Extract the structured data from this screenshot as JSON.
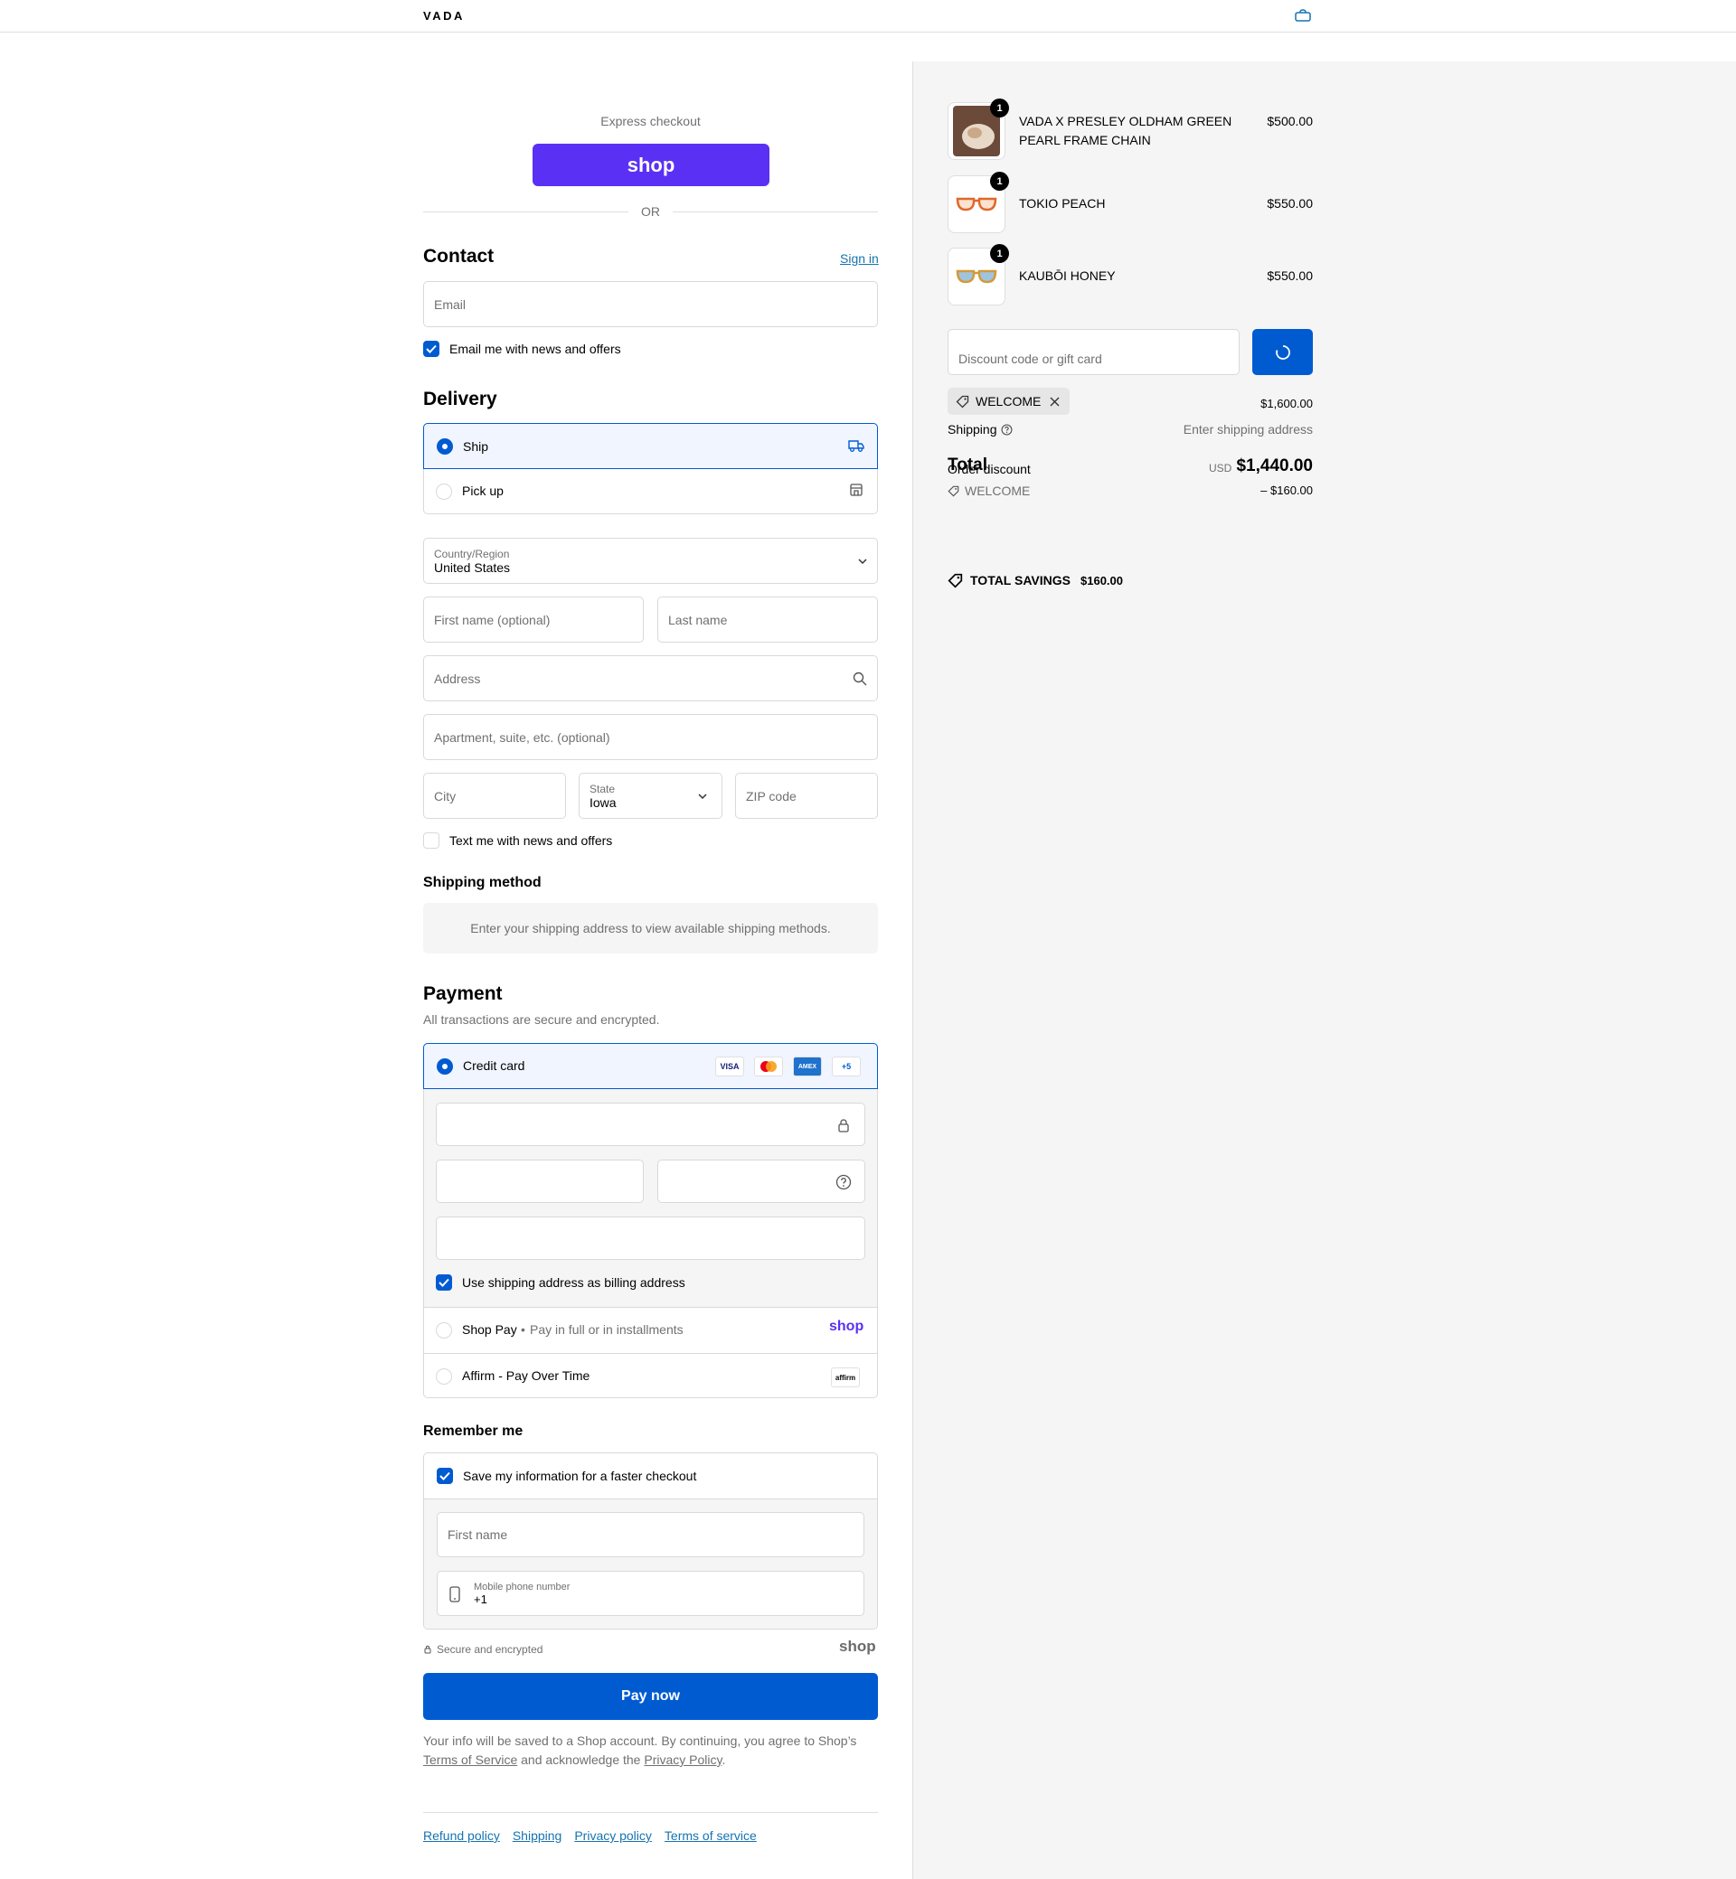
{
  "header": {
    "logo": "VADA",
    "cart_icon": "bag-icon"
  },
  "express": {
    "label": "Express checkout",
    "shop_button": "shop",
    "or": "OR"
  },
  "contact": {
    "title": "Contact",
    "sign_in": "Sign in",
    "email_placeholder": "Email",
    "email_news": "Email me with news and offers",
    "email_news_checked": true
  },
  "delivery": {
    "title": "Delivery",
    "options": [
      {
        "label": "Ship",
        "selected": true,
        "icon": "truck-icon"
      },
      {
        "label": "Pick up",
        "selected": false,
        "icon": "store-icon"
      }
    ],
    "country_label": "Country/Region",
    "country_value": "United States",
    "first_name_placeholder": "First name (optional)",
    "last_name_placeholder": "Last name",
    "address_placeholder": "Address",
    "apartment_placeholder": "Apartment, suite, etc. (optional)",
    "city_placeholder": "City",
    "state_label": "State",
    "state_value": "Iowa",
    "zip_placeholder": "ZIP code",
    "text_news": "Text me with news and offers",
    "text_news_checked": false
  },
  "shipping_method": {
    "title": "Shipping method",
    "message": "Enter your shipping address to view available shipping methods."
  },
  "payment": {
    "title": "Payment",
    "subtitle": "All transactions are secure and encrypted.",
    "credit_card_label": "Credit card",
    "card_brands": [
      "VISA",
      "Mastercard",
      "AMEX",
      "+5"
    ],
    "billing_same": "Use shipping address as billing address",
    "billing_same_checked": true,
    "shop_pay_label": "Shop Pay",
    "shop_pay_sub": "Pay in full or in installments",
    "shop_pay_logo": "shop",
    "affirm_label": "Affirm - Pay Over Time",
    "affirm_logo": "affirm"
  },
  "remember": {
    "title": "Remember me",
    "save_info": "Save my information for a faster checkout",
    "save_info_checked": true,
    "first_name_placeholder": "First name",
    "phone_label": "Mobile phone number",
    "phone_value": "+1",
    "secure": "Secure and encrypted",
    "shop_logo": "shop"
  },
  "pay_now": "Pay now",
  "legal": {
    "text_before": "Your info will be saved to a Shop account. By continuing, you agree to Shop’s",
    "terms": "Terms of Service",
    "middle": "and acknowledge the",
    "privacy": "Privacy Policy",
    "end": "."
  },
  "footer_links": [
    "Refund policy",
    "Shipping",
    "Privacy policy",
    "Terms of service"
  ],
  "summary": {
    "items": [
      {
        "name": "VADA X PRESLEY OLDHAM GREEN PEARL FRAME CHAIN",
        "price": "$500.00",
        "qty": "1"
      },
      {
        "name": "TOKIO PEACH",
        "price": "$550.00",
        "qty": "1"
      },
      {
        "name": "KAUBŌI HONEY",
        "price": "$550.00",
        "qty": "1"
      }
    ],
    "discount_placeholder": "Discount code or gift card",
    "applied_code": "WELCOME",
    "subtotal_value": "$1,600.00",
    "shipping_label": "Shipping",
    "shipping_value": "Enter shipping address",
    "total_label": "Total",
    "order_discount_label": "Order discount",
    "currency": "USD",
    "total_value": "$1,440.00",
    "discount_code": "WELCOME",
    "discount_value": "– $160.00",
    "total_savings_label": "TOTAL SAVINGS",
    "total_savings_value": "$160.00"
  },
  "colors": {
    "accent": "#005bd1",
    "shop_purple": "#5a31f4",
    "link": "#1773b0"
  }
}
